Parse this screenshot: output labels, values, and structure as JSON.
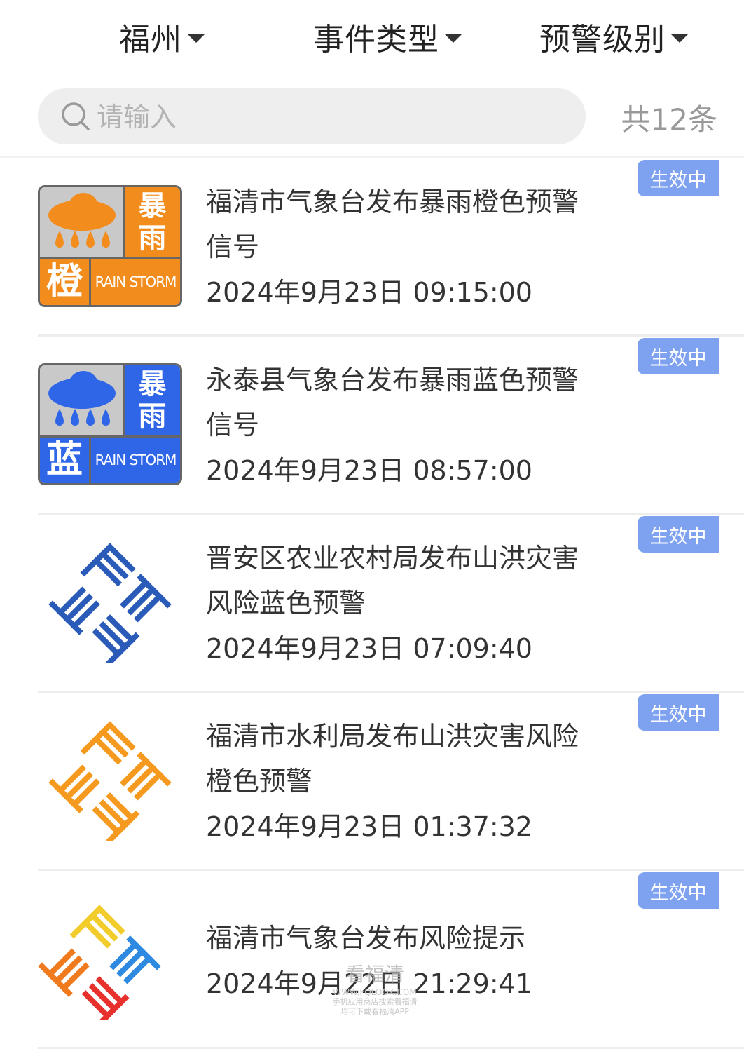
{
  "filters": {
    "city": "福州",
    "event_type": "事件类型",
    "warning_level": "预警级别"
  },
  "search": {
    "placeholder": "请输入",
    "total": "共12条"
  },
  "colors": {
    "badge_bg": "#7ea2ef",
    "orange": "#f28c1c",
    "blue": "#2f66e8"
  },
  "items": [
    {
      "title_line1": "福清市气象台发布暴雨橙色预警",
      "title_line2": "信号",
      "time": "2024年9月23日 09:15:00",
      "status": "生效中",
      "icon": "rainstorm-orange-icon",
      "icon_text": {
        "top": "暴",
        "bottom": "雨",
        "level": "橙",
        "en": "RAIN STORM"
      }
    },
    {
      "title_line1": "永泰县气象台发布暴雨蓝色预警",
      "title_line2": "信号",
      "time": "2024年9月23日 08:57:00",
      "status": "生效中",
      "icon": "rainstorm-blue-icon",
      "icon_text": {
        "top": "暴",
        "bottom": "雨",
        "level": "蓝",
        "en": "RAIN STORM"
      }
    },
    {
      "title_line1": "晋安区农业农村局发布山洪灾害",
      "title_line2": "风险蓝色预警",
      "time": "2024年9月23日 07:09:40",
      "status": "生效中",
      "icon": "emergency-logo-blue-icon"
    },
    {
      "title_line1": "福清市水利局发布山洪灾害风险",
      "title_line2": "橙色预警",
      "time": "2024年9月23日 01:37:32",
      "status": "生效中",
      "icon": "emergency-logo-orange-icon"
    },
    {
      "title_line1": "福清市气象台发布风险提示",
      "time": "2024年9月22日 21:29:41",
      "status": "生效中",
      "icon": "emergency-logo-multicolor-icon"
    }
  ],
  "watermark": {
    "brand": "看福清",
    "site": "WWW.FQLOOK.COM",
    "line1": "手机应用商店搜索看福清",
    "line2": "均可下载看福清APP"
  }
}
